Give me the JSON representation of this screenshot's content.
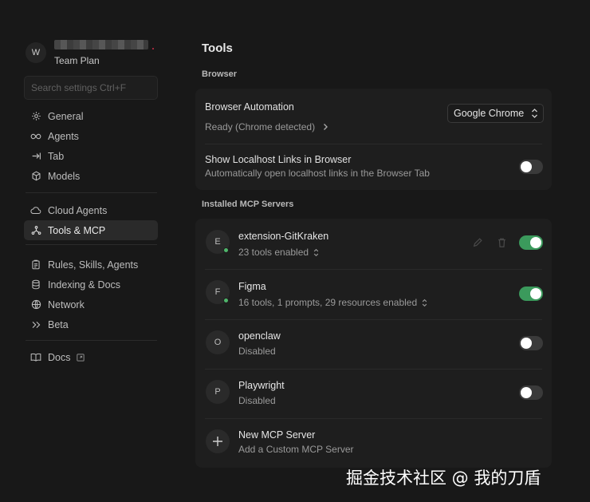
{
  "account": {
    "initial": "W",
    "plan": "Team Plan"
  },
  "search": {
    "placeholder": "Search settings Ctrl+F"
  },
  "nav": {
    "group1": [
      {
        "label": "General",
        "icon": "gear-icon"
      },
      {
        "label": "Agents",
        "icon": "infinity-icon"
      },
      {
        "label": "Tab",
        "icon": "tab-arrow-icon"
      },
      {
        "label": "Models",
        "icon": "cube-icon"
      }
    ],
    "group2": [
      {
        "label": "Cloud Agents",
        "icon": "cloud-icon"
      },
      {
        "label": "Tools & MCP",
        "icon": "tools-icon",
        "active": true
      }
    ],
    "group3": [
      {
        "label": "Rules, Skills, Agents",
        "icon": "clipboard-icon"
      },
      {
        "label": "Indexing & Docs",
        "icon": "database-icon"
      },
      {
        "label": "Network",
        "icon": "globe-icon"
      },
      {
        "label": "Beta",
        "icon": "double-chevron-icon"
      }
    ],
    "docs": {
      "label": "Docs",
      "icon": "book-icon"
    }
  },
  "page": {
    "title": "Tools"
  },
  "browser": {
    "section": "Browser",
    "automation_label": "Browser Automation",
    "automation_status": "Ready (Chrome detected)",
    "browser_select": "Google Chrome",
    "localhost_label": "Show Localhost Links in Browser",
    "localhost_desc": "Automatically open localhost links in the Browser Tab",
    "localhost_enabled": false
  },
  "mcp": {
    "section": "Installed MCP Servers",
    "servers": [
      {
        "initial": "E",
        "name": "extension-GitKraken",
        "status": "23 tools enabled",
        "enabled": true,
        "online": true
      },
      {
        "initial": "F",
        "name": "Figma",
        "status": "16 tools, 1 prompts, 29 resources enabled",
        "enabled": true,
        "online": true
      },
      {
        "initial": "O",
        "name": "openclaw",
        "status": "Disabled",
        "enabled": false,
        "online": false
      },
      {
        "initial": "P",
        "name": "Playwright",
        "status": "Disabled",
        "enabled": false,
        "online": false
      }
    ],
    "new_server": {
      "label": "New MCP Server",
      "desc": "Add a Custom MCP Server"
    }
  },
  "watermark": "掘金技术社区 @ 我的刀盾",
  "colors": {
    "accent_green": "#3b9a5c",
    "status_green": "#4fb66b",
    "background": "#181818",
    "card": "#1e1e1e"
  }
}
